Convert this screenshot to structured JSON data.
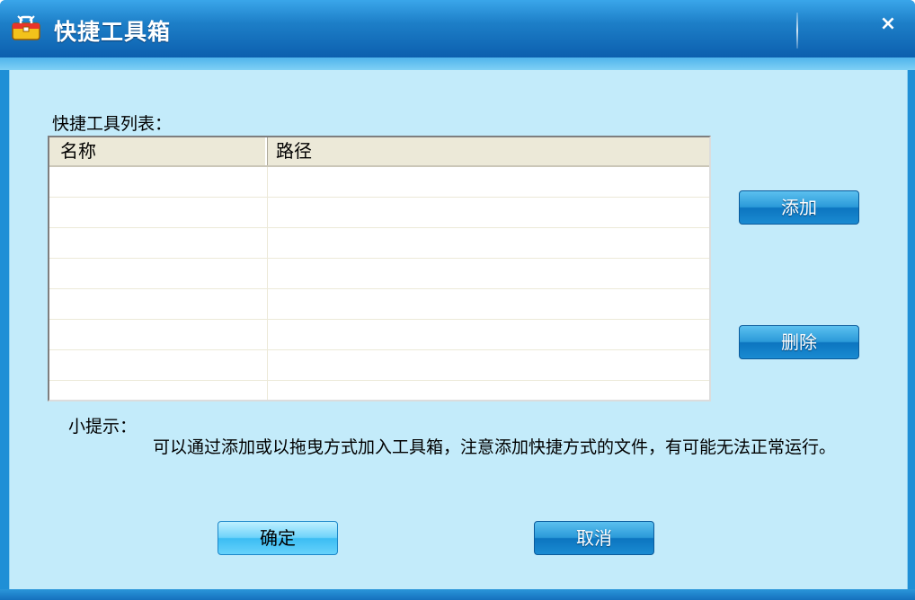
{
  "window": {
    "title": "快捷工具箱",
    "close_label": "×"
  },
  "list": {
    "label": "快捷工具列表：",
    "columns": [
      "名称",
      "路径"
    ],
    "rows": []
  },
  "buttons": {
    "add": "添加",
    "delete": "删除",
    "ok": "确定",
    "cancel": "取消"
  },
  "tip": {
    "title": "小提示：",
    "body": "可以通过添加或以拖曳方式加入工具箱，注意添加快捷方式的文件，有可能无法正常运行。"
  },
  "icons": {
    "app": "toolbox-icon",
    "close": "close-icon"
  },
  "colors": {
    "titlebar": "#1d7fc8",
    "client_bg": "#c3ebfa",
    "button": "#1a8bd1",
    "button_primary": "#6fd3fa"
  }
}
